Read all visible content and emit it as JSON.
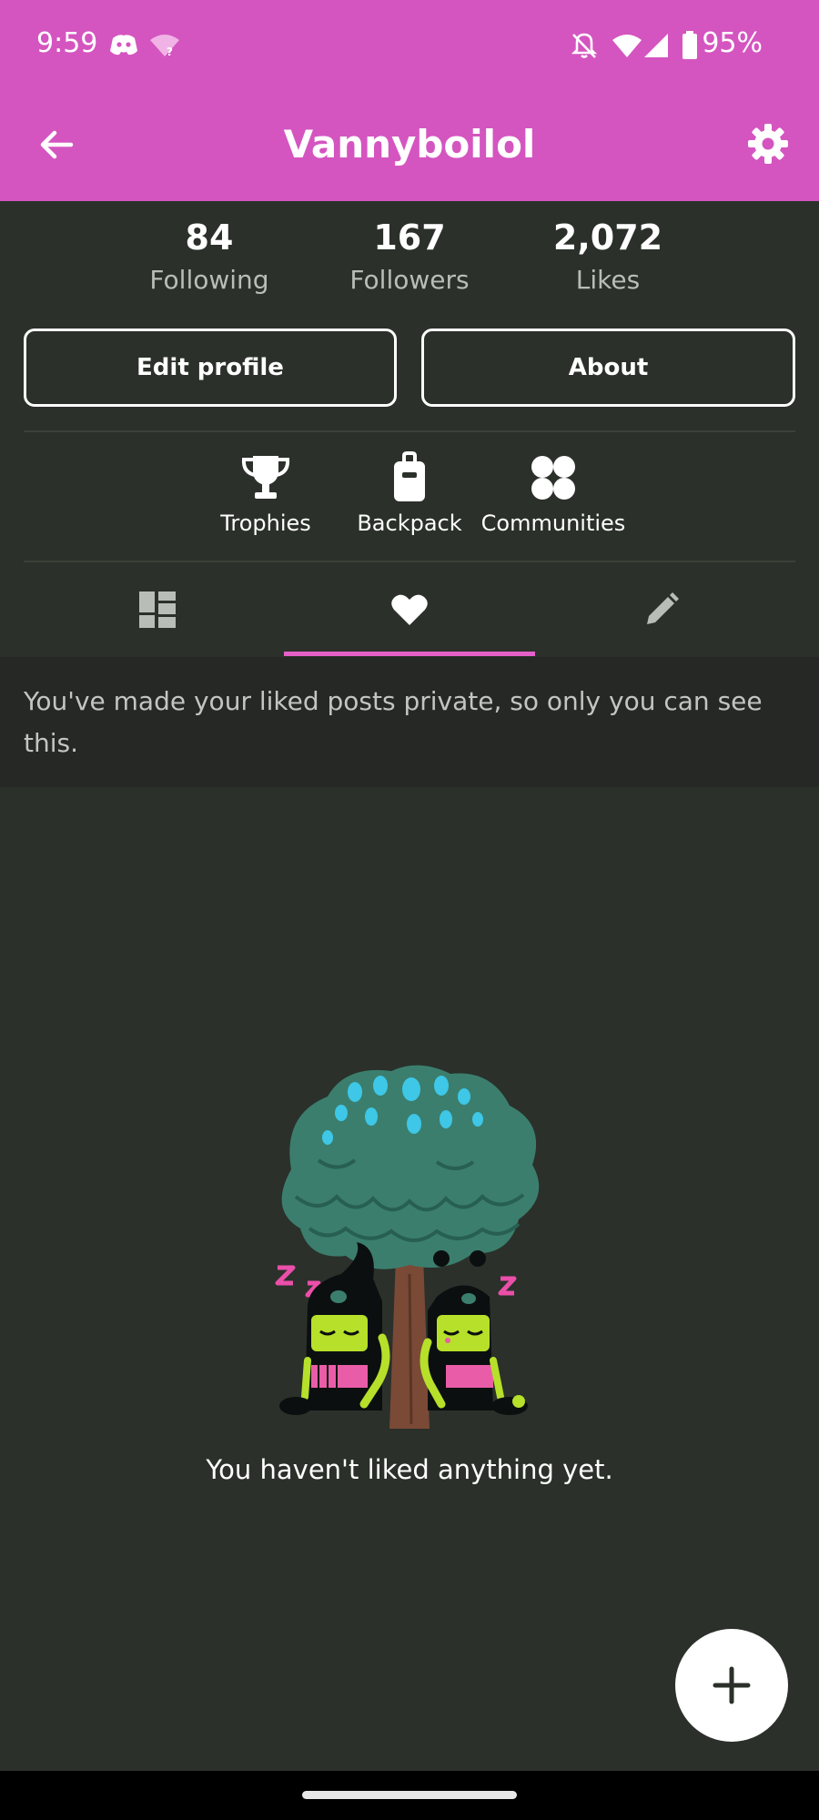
{
  "status_bar": {
    "time": "9:59",
    "battery": "95%",
    "icons": [
      "discord-icon",
      "wifi-question-icon",
      "bell-off-icon",
      "wifi-icon",
      "signal-icon",
      "battery-icon"
    ]
  },
  "app_bar": {
    "title": "Vannyboilol",
    "back_icon": "arrow-left-icon",
    "settings_icon": "gear-icon"
  },
  "stats": [
    {
      "value": "84",
      "label": "Following"
    },
    {
      "value": "167",
      "label": "Followers"
    },
    {
      "value": "2,072",
      "label": "Likes"
    }
  ],
  "buttons": {
    "edit_profile": "Edit profile",
    "about": "About"
  },
  "shortcuts": [
    {
      "label": "Trophies",
      "icon": "trophy-icon"
    },
    {
      "label": "Backpack",
      "icon": "backpack-icon"
    },
    {
      "label": "Communities",
      "icon": "communities-icon"
    }
  ],
  "tabs": [
    {
      "icon": "posts-grid-icon",
      "selected": false
    },
    {
      "icon": "heart-icon",
      "selected": true
    },
    {
      "icon": "pencil-icon",
      "selected": false
    }
  ],
  "notice": "You've made your liked posts private, so only you can see this.",
  "empty_state": {
    "message": "You haven't liked anything yet."
  },
  "fab_icon": "plus-icon",
  "colors": {
    "accent_pink": "#d455c0",
    "background": "#2b302a",
    "tab_indicator": "#e55fc8"
  }
}
